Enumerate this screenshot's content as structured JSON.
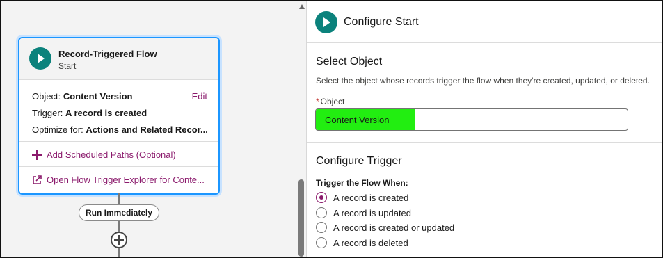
{
  "flow_card": {
    "title": "Record-Triggered Flow",
    "subtitle": "Start",
    "object_label": "Object:",
    "object_value": "Content Version",
    "edit_label": "Edit",
    "trigger_label": "Trigger:",
    "trigger_value": "A record is created",
    "optimize_label": "Optimize for:",
    "optimize_value": "Actions and Related Recor...",
    "add_paths_label": "Add Scheduled Paths (Optional)",
    "open_explorer_label": "Open Flow Trigger Explorer for Conte..."
  },
  "canvas": {
    "run_pill_label": "Run Immediately"
  },
  "panel": {
    "title": "Configure Start",
    "select_object": {
      "heading": "Select Object",
      "help": "Select the object whose records trigger the flow when they're created, updated, or deleted.",
      "field_label": "Object",
      "field_value": "Content Version",
      "highlight_color": "#22ee11"
    },
    "configure_trigger": {
      "heading": "Configure Trigger",
      "group_label": "Trigger the Flow When:",
      "options": [
        {
          "label": "A record is created",
          "checked": true
        },
        {
          "label": "A record is updated",
          "checked": false
        },
        {
          "label": "A record is created or updated",
          "checked": false
        },
        {
          "label": "A record is deleted",
          "checked": false
        }
      ]
    }
  },
  "colors": {
    "accent_teal": "#0b827c",
    "link": "#8b1a6c",
    "selection_blue": "#1b96ff"
  },
  "icons": {
    "start": "play-icon",
    "add": "plus-icon",
    "external": "external-link-icon"
  }
}
